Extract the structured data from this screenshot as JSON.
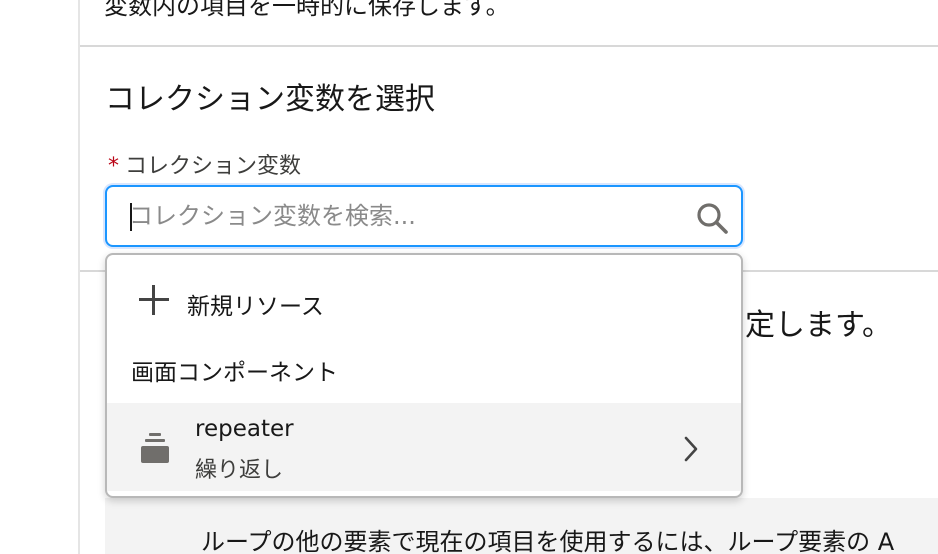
{
  "header": {
    "truncated_description": "変数内の項目を一時的に保存します。"
  },
  "section": {
    "title": "コレクション変数を選択",
    "field_label": "コレクション変数",
    "required_marker": "*",
    "search_placeholder": "コレクション変数を検索...",
    "search_value": ""
  },
  "background": {
    "partial_text": "定します。",
    "info_text": "ループの他の要素で現在の項目を使用するには、ループ要素の A"
  },
  "dropdown": {
    "new_resource_label": "新規リソース",
    "group_heading": "画面コンポーネント",
    "options": [
      {
        "name": "repeater",
        "subtitle": "繰り返し",
        "icon": "stack-icon"
      }
    ]
  },
  "icons": {
    "search": "search-icon",
    "add": "plus-icon",
    "expand": "chevron-right-icon"
  },
  "colors": {
    "focus_border": "#1b96ff",
    "required": "#ba0517",
    "highlight_row": "#f3f3f3"
  }
}
